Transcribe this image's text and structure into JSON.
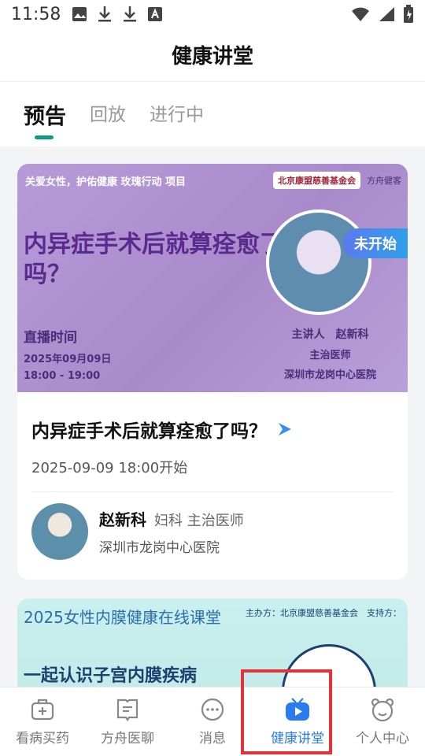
{
  "status_bar": {
    "time": "11:58"
  },
  "header": {
    "title": "健康讲堂"
  },
  "tabs": [
    {
      "label": "预告",
      "active": true
    },
    {
      "label": "回放",
      "active": false
    },
    {
      "label": "进行中",
      "active": false
    }
  ],
  "card": {
    "banner": {
      "top_text": "关爱女性，护佑健康 玫瑰行动 项目",
      "org_text": "北京康盟慈善基金会",
      "brand_text": "方舟健客",
      "headline": "内异症手术后就算痊愈了吗？",
      "live_label": "直播时间",
      "live_date": "2025年09月09日",
      "live_time": "18:00 - 19:00",
      "speaker": "主讲人　赵新科",
      "speaker_title": "主治医师",
      "speaker_hospital": "深圳市龙岗中心医院"
    },
    "title": "内异症手术后就算痊愈了吗？",
    "start": "2025-09-09 18:00开始",
    "status": "未开始",
    "doctor": {
      "name": "赵新科",
      "role": "妇科 主治医师",
      "hospital": "深圳市龙岗中心医院"
    }
  },
  "card2": {
    "title": "2025女性内膜健康在线课堂",
    "subtitle": "一起认识子宫内膜疾病",
    "org": "主办方：北京康盟慈善基金会　支持方："
  },
  "tabbar": [
    {
      "label": "看病买药",
      "icon": "medicine-box-icon"
    },
    {
      "label": "方舟医聊",
      "icon": "chat-book-icon"
    },
    {
      "label": "消息",
      "icon": "message-icon"
    },
    {
      "label": "健康讲堂",
      "icon": "video-icon",
      "active": true
    },
    {
      "label": "个人中心",
      "icon": "profile-icon"
    }
  ],
  "colors": {
    "accent": "#16957f",
    "active_tab": "#2a7bf0",
    "badge": "#4b85ee"
  }
}
